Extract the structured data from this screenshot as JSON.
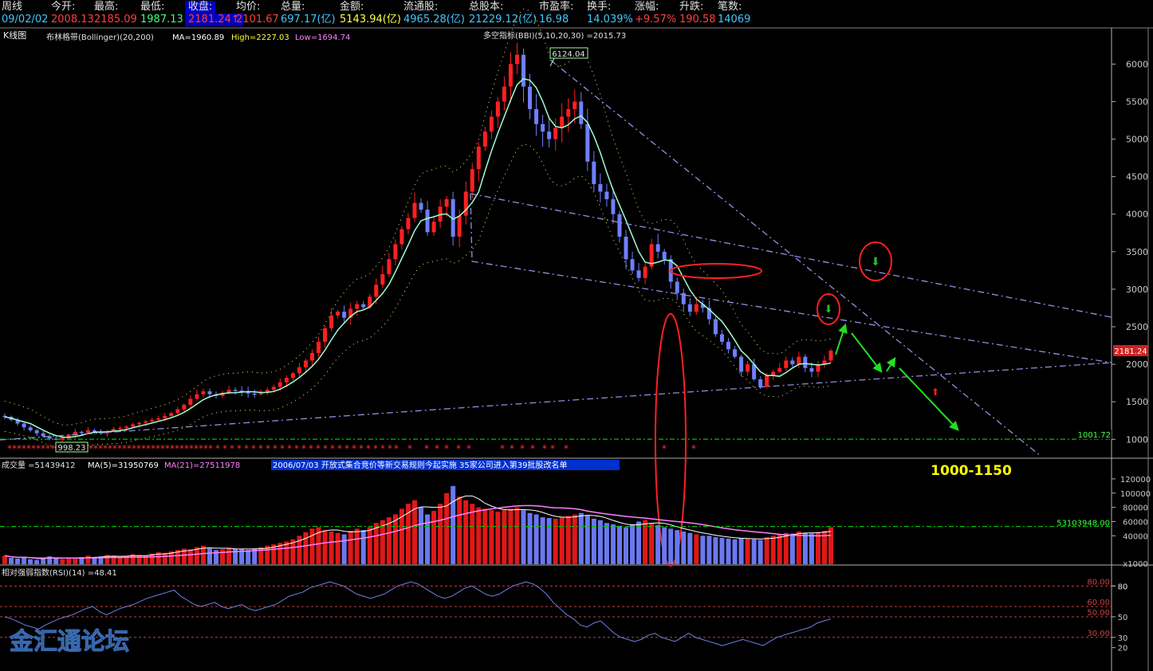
{
  "header": {
    "cells": [
      {
        "label": "周线",
        "value": "09/02/02",
        "vcolor": "#40c8ff"
      },
      {
        "label": "今开:",
        "value": "2008.13",
        "vcolor": "#ff4040"
      },
      {
        "label": "最高:",
        "value": "2185.09",
        "vcolor": "#ff4040"
      },
      {
        "label": "最低:",
        "value": "1987.13",
        "vcolor": "#40ff80"
      },
      {
        "label": "收盘:",
        "value": "2181.24↑",
        "vcolor": "#ff4040"
      },
      {
        "label": "均价:",
        "value": "2101.67",
        "vcolor": "#ff4040"
      },
      {
        "label": "总量:",
        "value": "697.17(亿)",
        "vcolor": "#40c8ff"
      },
      {
        "label": "金额:",
        "value": "5143.94(亿)",
        "vcolor": "#ffff40"
      },
      {
        "label": "流通股:",
        "value": "4965.28(亿)",
        "vcolor": "#40c8ff"
      },
      {
        "label": "总股本:",
        "value": "21229.12(亿)",
        "vcolor": "#40c8ff"
      },
      {
        "label": "市盈率:",
        "value": "16.98",
        "vcolor": "#40c8ff"
      },
      {
        "label": "换手:",
        "value": "14.039%",
        "vcolor": "#40c8ff"
      },
      {
        "label": "涨幅:",
        "value": "+9.57%",
        "vcolor": "#ff4040"
      },
      {
        "label": "升跌:",
        "value": "190.58",
        "vcolor": "#ff4040"
      },
      {
        "label": "笔数:",
        "value": "14069",
        "vcolor": "#40c8ff"
      }
    ]
  },
  "main_panel": {
    "title": "K线图",
    "boll_label": "布林格带(Bollinger)(20,200)",
    "boll_ma": "MA=1960.89",
    "boll_high": "High=2227.03",
    "boll_low": "Low=1694.74",
    "bbi_label": "多空指标(BBI)(5,10,20,30) =2015.73",
    "peak_label": "6124.04",
    "low_label": "998.23",
    "last_price_tag": "2181.24",
    "support_line_label": "1001.72",
    "target_annotation": "1000-1150"
  },
  "volume_panel": {
    "title": "成交量 =51439412",
    "ma5": "MA(5)=31950769",
    "ma21": "MA(21)=27511978",
    "news_banner": "2006/07/03 开放式集合竞价等新交易规则今起实施 35家公司进入第39批股改名单",
    "ref_line_label": "53103948.00",
    "unit_label": "x1000"
  },
  "rsi_panel": {
    "title": "相对强弱指数(RSI)(14) =48.41",
    "level_labels": [
      "80.00",
      "60.00",
      "50.00",
      "30.00"
    ]
  },
  "watermark": "金汇通论坛",
  "colors": {
    "up": "#ff2020",
    "down": "#6f7fff",
    "ma": "#a0ffd0",
    "trend": "#9090e0",
    "support": "#00c000",
    "annotation_circle": "#ff2020",
    "arrow": "#20e020"
  },
  "chart_data": {
    "type": "candlestick",
    "title": "K线图",
    "x_scale": "weekly",
    "y_axis_price": {
      "ticks": [
        1000,
        1500,
        2000,
        2500,
        3000,
        3500,
        4000,
        4500,
        5000,
        5500,
        6000
      ],
      "ylim": [
        780,
        6450
      ]
    },
    "y_axis_volume": {
      "ticks": [
        40000,
        60000,
        80000,
        100000,
        120000
      ],
      "unit": "x1000"
    },
    "y_axis_rsi": {
      "ticks": [
        20,
        30,
        50,
        80
      ],
      "ylim": [
        5,
        95
      ]
    },
    "key_points": [
      {
        "label": "low",
        "value": 998.23
      },
      {
        "label": "peak",
        "value": 6124.04
      },
      {
        "label": "last_close",
        "value": 2181.24
      }
    ],
    "price_path": [
      1300,
      1260,
      1210,
      1160,
      1120,
      1080,
      1040,
      1010,
      998,
      1020,
      1060,
      1100,
      1090,
      1120,
      1100,
      1080,
      1110,
      1140,
      1150,
      1170,
      1200,
      1220,
      1240,
      1260,
      1280,
      1310,
      1350,
      1400,
      1460,
      1540,
      1600,
      1640,
      1600,
      1580,
      1620,
      1660,
      1650,
      1640,
      1610,
      1600,
      1620,
      1660,
      1700,
      1760,
      1820,
      1880,
      1960,
      2050,
      2150,
      2300,
      2480,
      2650,
      2700,
      2620,
      2740,
      2800,
      2760,
      2900,
      3060,
      3200,
      3400,
      3600,
      3800,
      3950,
      4150,
      4060,
      3760,
      3900,
      4100,
      4200,
      3700,
      3980,
      4300,
      4600,
      4900,
      5100,
      5300,
      5500,
      5700,
      6000,
      6124,
      5700,
      5400,
      5200,
      5100,
      5000,
      5150,
      5300,
      5400,
      5500,
      5200,
      4700,
      4400,
      4300,
      4200,
      4000,
      3700,
      3400,
      3250,
      3150,
      3300,
      3600,
      3500,
      3400,
      3100,
      2950,
      2800,
      2700,
      2800,
      2750,
      2600,
      2400,
      2300,
      2200,
      2100,
      1900,
      2000,
      1800,
      1700,
      1850,
      1900,
      1950,
      2050,
      2000,
      2100,
      1950,
      1900,
      2000,
      2050,
      2181
    ],
    "volume_path": [
      12000,
      9000,
      8000,
      10000,
      7000,
      6000,
      9000,
      11000,
      8000,
      7000,
      9000,
      8000,
      10000,
      12000,
      9000,
      11000,
      13000,
      12000,
      10000,
      11000,
      14000,
      13000,
      12000,
      15000,
      17000,
      16000,
      18000,
      20000,
      22000,
      21000,
      24000,
      26000,
      22000,
      20000,
      21000,
      23000,
      22000,
      21000,
      20000,
      22000,
      24000,
      26000,
      28000,
      30000,
      32000,
      35000,
      40000,
      45000,
      50000,
      52000,
      48000,
      46000,
      44000,
      42000,
      47000,
      50000,
      48000,
      52000,
      58000,
      62000,
      66000,
      70000,
      78000,
      85000,
      90000,
      80000,
      70000,
      75000,
      85000,
      100000,
      110000,
      95000,
      90000,
      85000,
      80000,
      78000,
      76000,
      74000,
      76000,
      78000,
      80000,
      76000,
      72000,
      70000,
      66000,
      65000,
      64000,
      66000,
      68000,
      70000,
      72000,
      68000,
      64000,
      62000,
      58000,
      56000,
      54000,
      52000,
      56000,
      60000,
      62000,
      58000,
      55000,
      52000,
      50000,
      48000,
      46000,
      44000,
      42000,
      40000,
      40000,
      38000,
      37000,
      36000,
      35000,
      37000,
      36000,
      35000,
      34000,
      38000,
      40000,
      42000,
      44000,
      43000,
      46000,
      44000,
      43000,
      45000,
      47000,
      52000
    ],
    "rsi_path": [
      50,
      48,
      45,
      42,
      40,
      38,
      42,
      45,
      48,
      50,
      52,
      55,
      58,
      60,
      55,
      52,
      55,
      58,
      60,
      62,
      65,
      68,
      70,
      72,
      74,
      76,
      70,
      66,
      62,
      60,
      62,
      64,
      60,
      58,
      60,
      62,
      58,
      56,
      58,
      60,
      62,
      66,
      70,
      72,
      74,
      78,
      80,
      82,
      84,
      82,
      80,
      76,
      72,
      70,
      68,
      70,
      72,
      76,
      80,
      82,
      84,
      82,
      78,
      74,
      70,
      68,
      70,
      74,
      78,
      80,
      76,
      72,
      70,
      72,
      76,
      80,
      82,
      84,
      82,
      78,
      72,
      64,
      58,
      52,
      48,
      42,
      40,
      44,
      46,
      40,
      34,
      30,
      28,
      26,
      28,
      32,
      34,
      30,
      28,
      26,
      30,
      34,
      30,
      28,
      26,
      24,
      22,
      24,
      26,
      28,
      26,
      24,
      22,
      26,
      30,
      32,
      34,
      36,
      38,
      40,
      44,
      46,
      48
    ]
  }
}
